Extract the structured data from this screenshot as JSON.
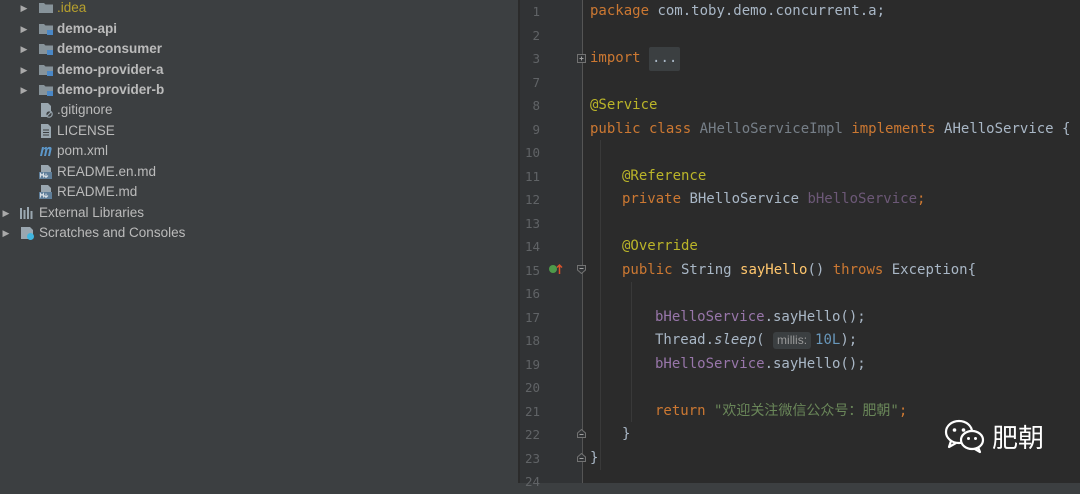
{
  "project_tree": {
    "items": [
      {
        "label": ".idea",
        "type": "folder",
        "expandable": true
      },
      {
        "label": "demo-api",
        "type": "module",
        "expandable": true
      },
      {
        "label": "demo-consumer",
        "type": "module",
        "expandable": true
      },
      {
        "label": "demo-provider-a",
        "type": "module",
        "expandable": true
      },
      {
        "label": "demo-provider-b",
        "type": "module",
        "expandable": true
      },
      {
        "label": ".gitignore",
        "type": "file",
        "expandable": false
      },
      {
        "label": "LICENSE",
        "type": "file",
        "expandable": false
      },
      {
        "label": "pom.xml",
        "type": "maven",
        "expandable": false
      },
      {
        "label": "README.en.md",
        "type": "markdown",
        "expandable": false
      },
      {
        "label": "README.md",
        "type": "markdown",
        "expandable": false
      },
      {
        "label": "External Libraries",
        "type": "libraries",
        "expandable": true
      },
      {
        "label": "Scratches and Consoles",
        "type": "scratches",
        "expandable": true
      }
    ]
  },
  "editor": {
    "line_numbers": [
      "1",
      "2",
      "3",
      "7",
      "8",
      "9",
      "10",
      "11",
      "12",
      "13",
      "14",
      "15",
      "16",
      "17",
      "18",
      "19",
      "20",
      "21",
      "22",
      "23",
      "24"
    ],
    "code": {
      "l1_kw": "package",
      "l1_pkg": " com.toby.demo.concurrent.a;",
      "l3_kw": "import",
      "l3_fold": "...",
      "l8_ann": "@Service",
      "l9_kw1": "public class",
      "l9_name": " AHelloServiceImpl ",
      "l9_kw2": "implements",
      "l9_rest": " AHelloService {",
      "l11_ann": "@Reference",
      "l12_kw": "private",
      "l12_type": " BHelloService ",
      "l12_field": "bHelloService",
      "l12_semi": ";",
      "l14_ann": "@Override",
      "l15_kw1": "public",
      "l15_type": " String ",
      "l15_method": "sayHello",
      "l15_paren": "() ",
      "l15_kw2": "throws",
      "l15_rest": " Exception{",
      "l17_field": "bHelloService",
      "l17_call": ".sayHello();",
      "l18_class": "Thread.",
      "l18_method": "sleep",
      "l18_open": "( ",
      "l18_hint": "millis:",
      "l18_num": "10L",
      "l18_close": ");",
      "l19_field": "bHelloService",
      "l19_call": ".sayHello();",
      "l21_kw": "return",
      "l21_str": " \"欢迎关注微信公众号：肥朝\"",
      "l21_semi": ";",
      "l22_brace": "}",
      "l23_brace": "}"
    }
  },
  "watermark": {
    "text": "肥朝",
    "icon": "wechat-icon"
  },
  "colors": {
    "keyword": "#cc7832",
    "annotation": "#bbb529",
    "method": "#ffc66d",
    "field": "#9876aa",
    "string": "#6a8759",
    "number": "#6897bb",
    "text": "#a9b7c6"
  }
}
